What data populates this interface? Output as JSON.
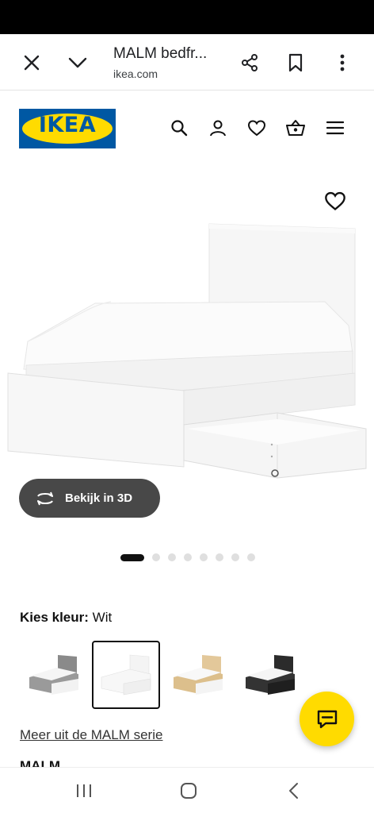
{
  "browser": {
    "title": "MALM bedfr...",
    "url": "ikea.com",
    "icons": [
      "close-icon",
      "chevron-down-icon",
      "share-icon",
      "bookmark-icon",
      "more-vert-icon"
    ]
  },
  "header": {
    "logo_text": "IKEA",
    "brand_colors": {
      "blue": "#0058a3",
      "yellow": "#ffdb00"
    },
    "icons": [
      "search-icon",
      "user-icon",
      "heart-icon",
      "basket-icon",
      "menu-icon"
    ]
  },
  "gallery": {
    "view_3d_label": "Bekijk in 3D",
    "image_count": 8,
    "active_index": 0
  },
  "colour": {
    "label": "Kies kleur:",
    "value": "Wit",
    "options": [
      {
        "name": "gray",
        "selected": false,
        "color": "#8a8a8a"
      },
      {
        "name": "white",
        "selected": true,
        "color": "#f4f4f4"
      },
      {
        "name": "oak",
        "selected": false,
        "color": "#e3c89a"
      },
      {
        "name": "black-brown",
        "selected": false,
        "color": "#2b2b2b"
      }
    ]
  },
  "series_link": "Meer uit de MALM serie",
  "next_heading": "MALM",
  "android_nav": [
    "recents-icon",
    "home-icon",
    "back-icon"
  ]
}
